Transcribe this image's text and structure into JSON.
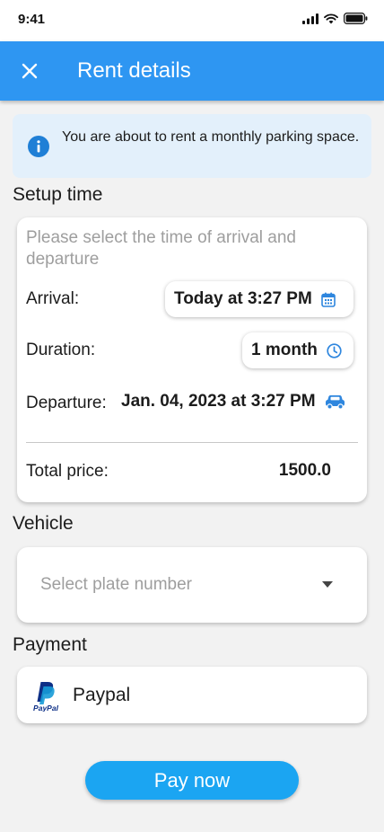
{
  "status_bar": {
    "time": "9:41"
  },
  "header": {
    "title": "Rent details",
    "close_icon": "close-icon"
  },
  "info_banner": {
    "icon": "info-icon",
    "text": "You are about to rent a monthly parking space."
  },
  "setup_time": {
    "title": "Setup time",
    "hint": "Please select the time of arrival and departure",
    "arrival": {
      "label": "Arrival:",
      "value": "Today at 3:27 PM",
      "icon": "calendar-icon"
    },
    "duration": {
      "label": "Duration:",
      "value": "1 month",
      "icon": "clock-icon"
    },
    "departure": {
      "label": "Departure:",
      "value": "Jan. 04, 2023 at 3:27 PM",
      "icon": "car-icon"
    },
    "total": {
      "label": "Total price:",
      "value": "1500.0"
    }
  },
  "vehicle": {
    "title": "Vehicle",
    "placeholder": "Select plate number",
    "icon": "dropdown-arrow-icon"
  },
  "payment": {
    "title": "Payment",
    "method": "Paypal",
    "logo_text": "PayPal"
  },
  "actions": {
    "pay_label": "Pay now"
  },
  "colors": {
    "primary": "#2e96f2",
    "button": "#1ba5f2",
    "info_bg": "#e3f0fb",
    "accent_icon": "#2e86de"
  }
}
